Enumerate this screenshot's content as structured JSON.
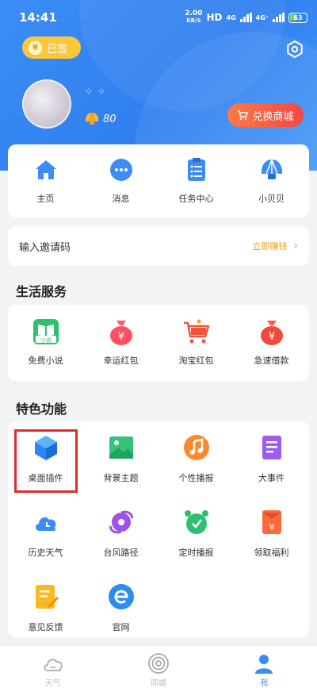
{
  "status_bar": {
    "time": "14:41",
    "net_speed_value": "2.00",
    "net_speed_unit": "KB/S",
    "hd": "HD",
    "signal_1": "4G",
    "signal_2": "4G⁺",
    "battery": "63"
  },
  "header": {
    "checkin_label": "已签",
    "checkin_coin": "¥",
    "nickname": "✧ ✧",
    "shell_count": "80",
    "mall_button_label": "兑换商城"
  },
  "quick_menu": [
    {
      "label": "主页",
      "icon": "home-icon"
    },
    {
      "label": "消息",
      "icon": "message-icon"
    },
    {
      "label": "任务中心",
      "icon": "task-icon"
    },
    {
      "label": "小贝贝",
      "icon": "shell-icon"
    }
  ],
  "invite": {
    "label": "输入邀请码",
    "action": "立即赚钱"
  },
  "life_services": {
    "title": "生活服务",
    "items": [
      {
        "label": "免费小说",
        "icon": "novel-icon",
        "badge": "小说"
      },
      {
        "label": "幸运红包",
        "icon": "money-bag-icon"
      },
      {
        "label": "淘宝红包",
        "icon": "shopping-cart-icon"
      },
      {
        "label": "急速借款",
        "icon": "loan-icon"
      }
    ]
  },
  "features": {
    "title": "特色功能",
    "items": [
      {
        "label": "桌面插件",
        "icon": "cube-icon",
        "highlighted": true
      },
      {
        "label": "背景主题",
        "icon": "image-icon"
      },
      {
        "label": "个性播报",
        "icon": "music-icon"
      },
      {
        "label": "大事件",
        "icon": "document-icon"
      },
      {
        "label": "历史天气",
        "icon": "cloud-clock-icon"
      },
      {
        "label": "台风路径",
        "icon": "typhoon-icon"
      },
      {
        "label": "定时播报",
        "icon": "alarm-clock-icon"
      },
      {
        "label": "领取福利",
        "icon": "red-envelope-icon"
      },
      {
        "label": "意见反馈",
        "icon": "feedback-icon"
      },
      {
        "label": "官网",
        "icon": "website-icon"
      }
    ]
  },
  "tab_bar": [
    {
      "label": "天气",
      "icon": "weather-tab-icon",
      "active": false
    },
    {
      "label": "同城",
      "icon": "local-tab-icon",
      "active": false
    },
    {
      "label": "我",
      "icon": "profile-tab-icon",
      "active": true
    }
  ],
  "colors": {
    "primary": "#3b8df5",
    "accent_orange": "#fcc83b",
    "highlight_red": "#e02b2b"
  }
}
